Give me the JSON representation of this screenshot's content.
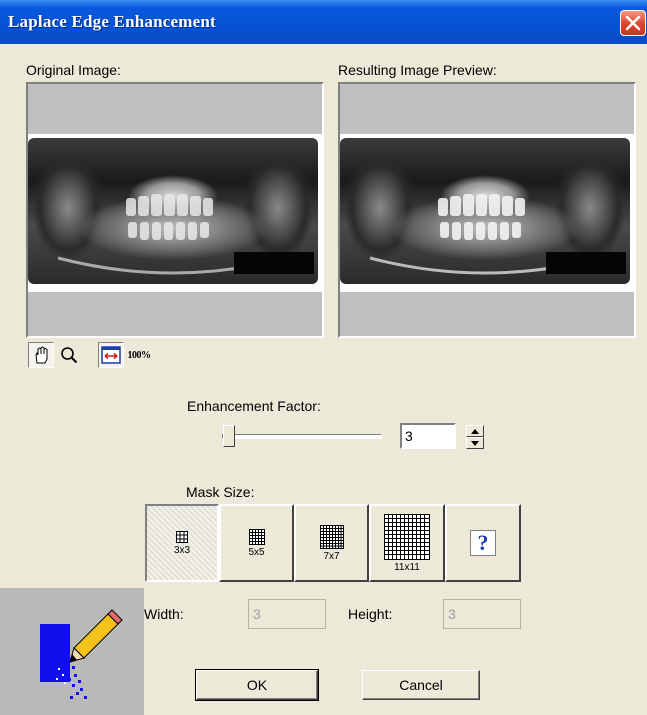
{
  "window": {
    "title": "Laplace Edge Enhancement",
    "background": "#ece9d8",
    "titlebar_color": "#0553d3"
  },
  "preview": {
    "original_label": "Original Image:",
    "result_label": "Resulting Image Preview:"
  },
  "toolbar": {
    "icons": [
      "hand-pan-icon",
      "magnifier-icon",
      "fit-to-window-icon",
      "zoom-100-icon"
    ],
    "zoom_100_label": "100%"
  },
  "enhancement": {
    "label": "Enhancement Factor:",
    "value": "3"
  },
  "mask": {
    "label": "Mask Size:",
    "selected": "3x3",
    "options": [
      {
        "label": "3x3"
      },
      {
        "label": "5x5"
      },
      {
        "label": "7x7"
      },
      {
        "label": "11x11"
      },
      {
        "label": "?"
      }
    ]
  },
  "size": {
    "width_label": "Width:",
    "width_value": "3",
    "height_label": "Height:",
    "height_value": "3"
  },
  "buttons": {
    "ok": "OK",
    "cancel": "Cancel"
  }
}
